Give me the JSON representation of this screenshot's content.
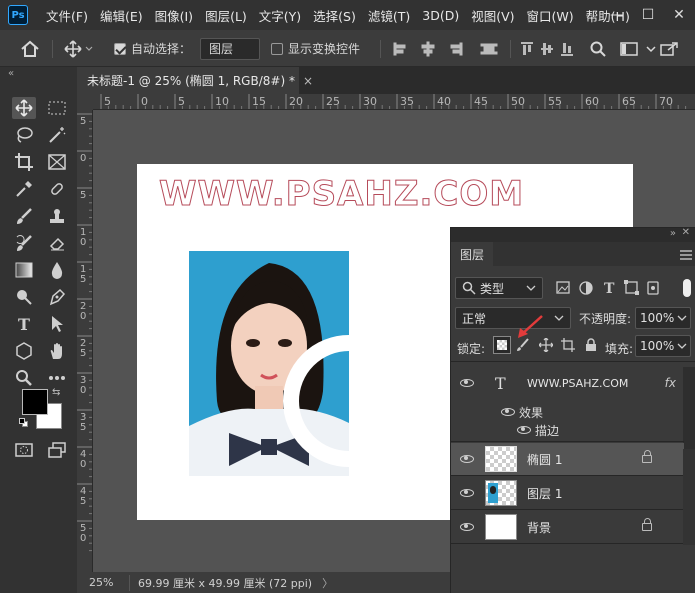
{
  "app": {
    "logo": "Ps"
  },
  "menu": [
    "文件(F)",
    "编辑(E)",
    "图像(I)",
    "图层(L)",
    "文字(Y)",
    "选择(S)",
    "滤镜(T)",
    "3D(D)",
    "视图(V)",
    "窗口(W)",
    "帮助(H)"
  ],
  "window_controls": {
    "minimize": "—",
    "maximize": "☐",
    "close": "✕"
  },
  "options": {
    "auto_select_label": "自动选择：",
    "auto_select_checked": true,
    "auto_select_target": "图层",
    "show_transform_label": "显示变换控件",
    "show_transform_checked": false
  },
  "document_tab": {
    "title": "未标题-1 @ 25% (椭圆 1, RGB/8#) *",
    "close": "×"
  },
  "ruler": {
    "h_labels": [
      "5",
      "0",
      "5",
      "10",
      "15",
      "20",
      "25",
      "30",
      "35",
      "40",
      "45",
      "50",
      "55",
      "60",
      "65",
      "70"
    ],
    "v_labels": [
      "5",
      "0",
      "5",
      "1\n0",
      "1\n5",
      "2\n0",
      "2\n5",
      "3\n0",
      "3\n5",
      "4\n0",
      "4\n5",
      "5\n0"
    ]
  },
  "canvas": {
    "watermark": "WWW.PSAHZ.COM"
  },
  "status": {
    "zoom": "25%",
    "doc_size": "69.99 厘米 x 49.99 厘米 (72 ppi)",
    "arrow": "〉"
  },
  "layers_panel": {
    "tab": "图层",
    "filter_kind": "类型",
    "blend_mode": "正常",
    "opacity_label": "不透明度:",
    "opacity_value": "100%",
    "lock_label": "锁定:",
    "fill_label": "填充:",
    "fill_value": "100%",
    "layers": [
      {
        "name": "WWW.PSAHZ.COM",
        "kind": "text",
        "fx": "fx",
        "effects_label": "效果",
        "effect": "描边"
      },
      {
        "name": "椭圆 1",
        "kind": "shape",
        "selected": true,
        "locked": true
      },
      {
        "name": "图层 1",
        "kind": "image"
      },
      {
        "name": "背景",
        "kind": "background",
        "locked": true
      }
    ]
  },
  "colors": {
    "menubar": "#323232",
    "panel": "#3a3a3a",
    "canvas": "#535353",
    "watermark_stroke": "#b64b5a",
    "photo_bg": "#2e9fcf",
    "annotation_arrow": "#e23b3b"
  }
}
